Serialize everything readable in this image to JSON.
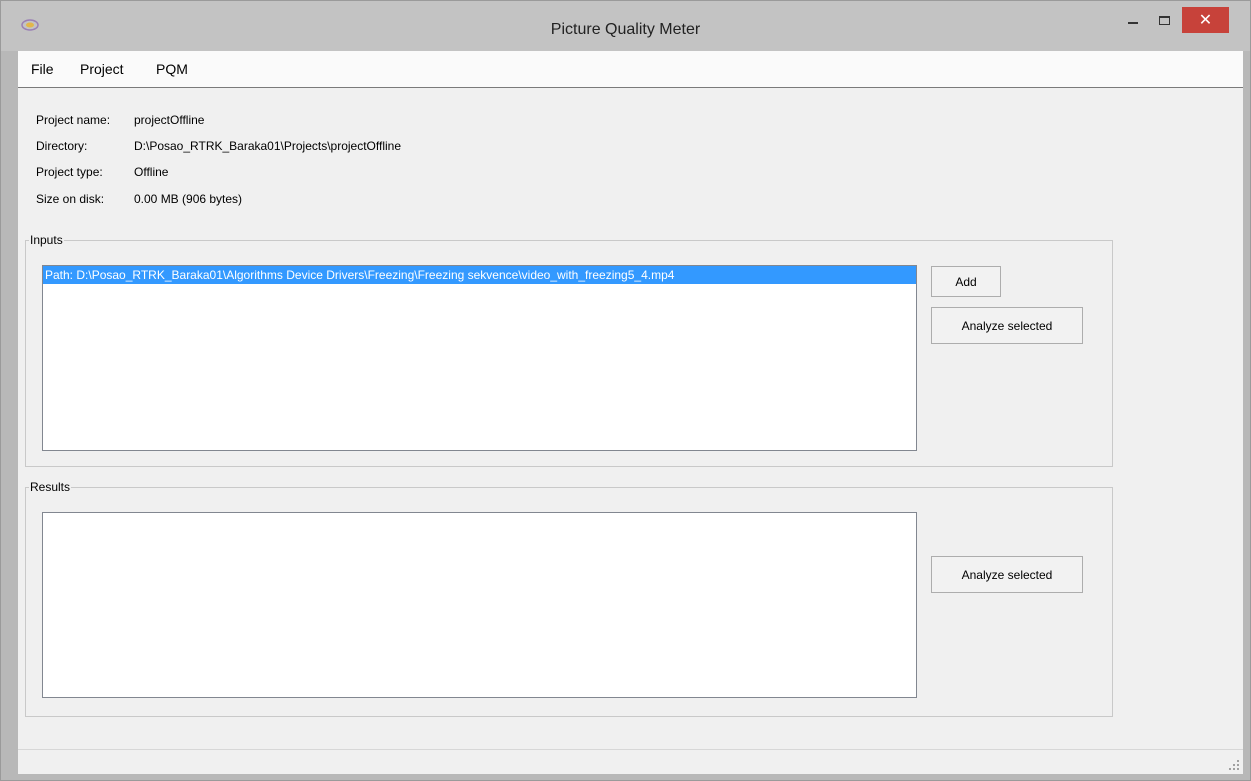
{
  "window": {
    "title": "Picture Quality Meter",
    "icon": "app-logo-icon",
    "controls": {
      "minimize": "minimize-icon",
      "maximize": "maximize-icon",
      "close": "close-icon",
      "close_glyph": "✕"
    },
    "close_color": "#c7423a"
  },
  "menu": {
    "file": "File",
    "project": "Project",
    "pqm": "PQM"
  },
  "project_info": {
    "name_label": "Project name:",
    "name_value": "projectOffline",
    "directory_label": "Directory:",
    "directory_value": "D:\\Posao_RTRK_Baraka01\\Projects\\projectOffline",
    "type_label": "Project type:",
    "type_value": "Offline",
    "size_label": "Size on disk:",
    "size_value": "0.00 MB (906 bytes)"
  },
  "inputs": {
    "legend": "Inputs",
    "items": [
      {
        "label": "Path: D:\\Posao_RTRK_Baraka01\\Algorithms Device Drivers\\Freezing\\Freezing sekvence\\video_with_freezing5_4.mp4",
        "selected": true
      }
    ],
    "add_label": "Add",
    "analyze_label": "Analyze selected"
  },
  "results": {
    "legend": "Results",
    "items": [],
    "analyze_label": "Analyze selected"
  },
  "colors": {
    "selection": "#3399ff",
    "title_bar": "#c3c3c3",
    "client_bg": "#f0f0f0"
  }
}
